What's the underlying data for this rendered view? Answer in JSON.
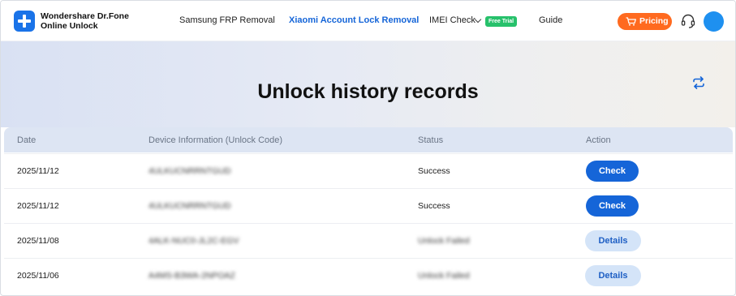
{
  "brand": {
    "line1": "Wondershare Dr.Fone",
    "line2": "Online Unlock"
  },
  "nav": {
    "items": [
      {
        "label": "Samsung FRP Removal"
      },
      {
        "label": "Xiaomi Account Lock Removal"
      },
      {
        "label": "IMEI Check"
      },
      {
        "label": "Guide"
      }
    ],
    "free_trial_badge": "Free Trial",
    "active_item": "Xiaomi Account Lock Removal"
  },
  "header_actions": {
    "pricing_label": "Pricing",
    "icons": [
      "cart-icon",
      "headset-icon",
      "user-avatar"
    ]
  },
  "page": {
    "title": "Unlock history records",
    "refresh_icon": "refresh-icon"
  },
  "table": {
    "columns": [
      "Date",
      "Device Information (Unlock Code)",
      "Status",
      "Action"
    ],
    "rows": [
      {
        "date": "2025/11/12",
        "device": "4ULKUCNRRNTGUD",
        "status": "Success",
        "action": "Check"
      },
      {
        "date": "2025/11/12",
        "device": "4ULKUCNRRNTGUD",
        "status": "Success",
        "action": "Check"
      },
      {
        "date": "2025/11/08",
        "device": "4ALK-NUC0-JL2C-EGV",
        "status": "Unlock Failed",
        "action": "Details"
      },
      {
        "date": "2025/11/06",
        "device": "A4MS-B3WA-2NPOAZ",
        "status": "Unlock Failed",
        "action": "Details"
      }
    ]
  },
  "colors": {
    "accent": "#1565d8",
    "pricing": "#ff6a1f",
    "free_trial": "#27c16b",
    "header_row": "#dde5f3",
    "details_button": "#d4e4f8"
  }
}
